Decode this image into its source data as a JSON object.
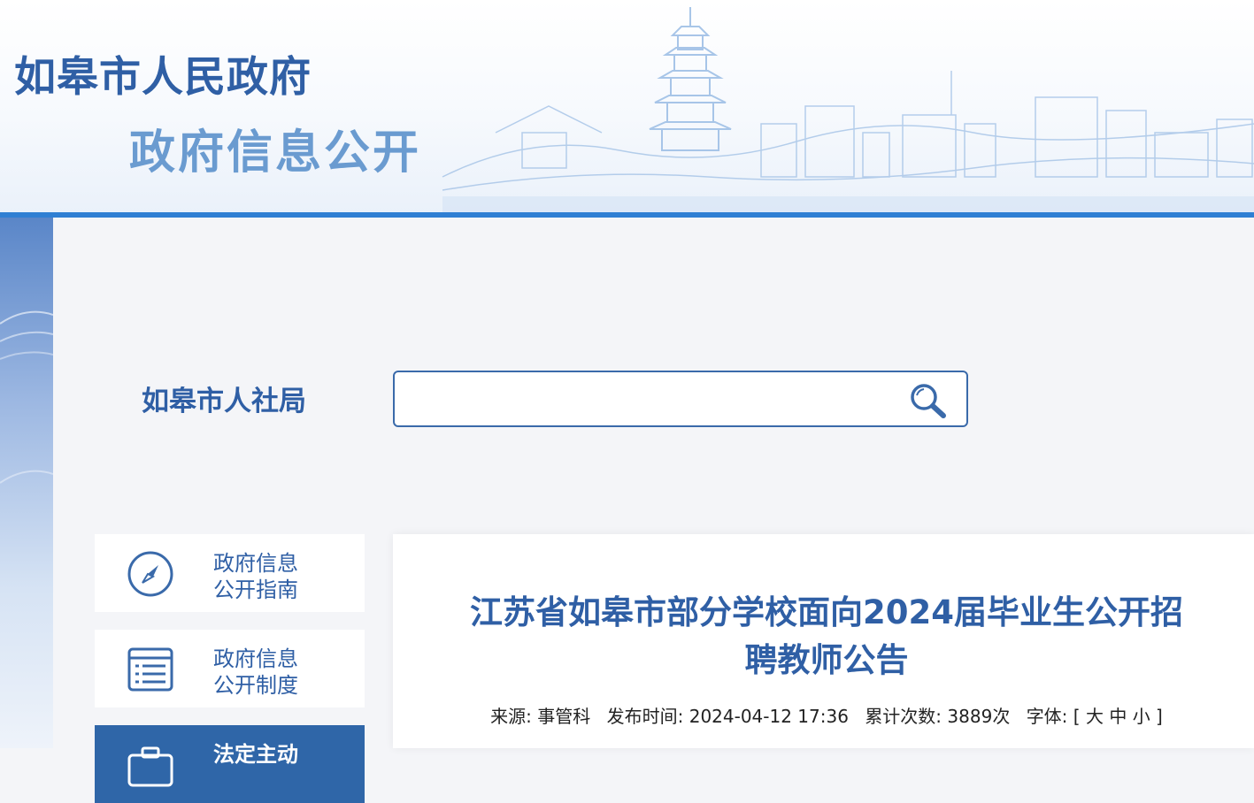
{
  "header": {
    "site_title": "如皋市人民政府",
    "site_subtitle": "政府信息公开",
    "accent_color": "#2f7fd3"
  },
  "org": {
    "name": "如皋市人社局"
  },
  "search": {
    "value": "",
    "placeholder": "",
    "icon": "search-icon"
  },
  "nav": {
    "items": [
      {
        "line1": "政府信息",
        "line2": "公开指南",
        "icon": "compass-icon"
      },
      {
        "line1": "政府信息",
        "line2": "公开制度",
        "icon": "list-document-icon"
      },
      {
        "line1": "法定主动",
        "line2": "",
        "icon": "briefcase-icon",
        "active": true
      }
    ]
  },
  "article": {
    "title_line1": "江苏省如皋市部分学校面向2024届毕业生公开招",
    "title_line2": "聘教师公告",
    "meta": {
      "source_label": "来源:",
      "source_value": "事管科",
      "date_label": "发布时间:",
      "date_value": "2024-04-12 17:36",
      "views_label": "累计次数:",
      "views_value": "3889次",
      "font_label": "字体:",
      "bracket_open": "[",
      "font_large": "大",
      "font_medium": "中",
      "font_small": "小",
      "bracket_close": "]"
    }
  }
}
